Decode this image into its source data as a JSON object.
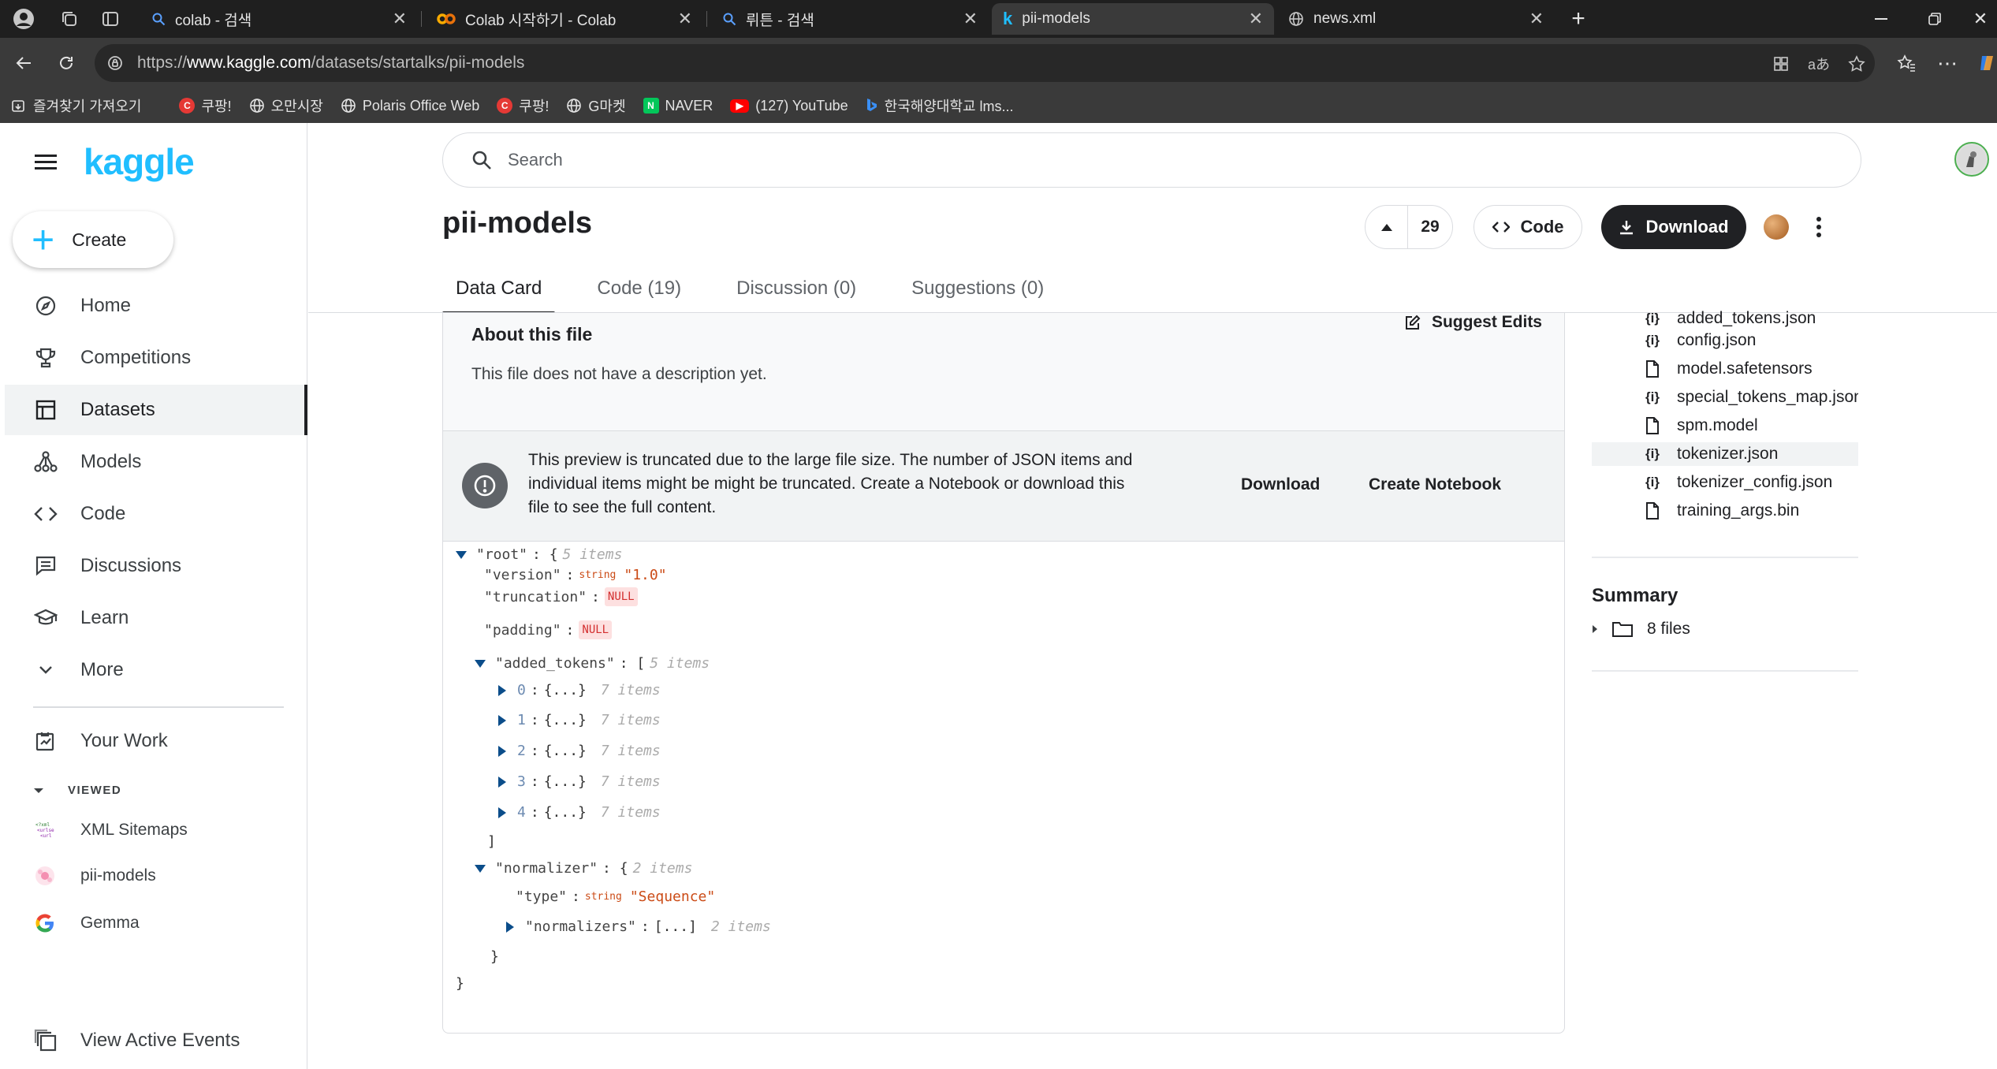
{
  "browser": {
    "tabs": [
      {
        "label": "colab - 검색",
        "icon": "bing-search-icon"
      },
      {
        "label": "Colab 시작하기 - Colab",
        "icon": "colab-icon"
      },
      {
        "label": "뤼튼 - 검색",
        "icon": "bing-search-icon"
      },
      {
        "label": "pii-models",
        "icon": "kaggle-icon",
        "active": true
      },
      {
        "label": "news.xml",
        "icon": "globe-icon"
      }
    ],
    "url_prefix": "https://",
    "url_host": "www.kaggle.com",
    "url_path": "/datasets/startalks/pii-models",
    "bookmarks": [
      {
        "label": "즐겨찾기 가져오기",
        "icon": "import-icon"
      },
      {
        "label": "쿠팡!",
        "icon": "coupang-icon"
      },
      {
        "label": "오만시장",
        "icon": "globe-icon"
      },
      {
        "label": "Polaris Office Web",
        "icon": "globe-icon"
      },
      {
        "label": "쿠팡!",
        "icon": "coupang-icon"
      },
      {
        "label": "G마켓",
        "icon": "globe-icon"
      },
      {
        "label": "NAVER",
        "icon": "naver-icon"
      },
      {
        "label": "(127) YouTube",
        "icon": "youtube-icon"
      },
      {
        "label": "한국해양대학교 lms...",
        "icon": "bing-icon"
      }
    ]
  },
  "sidebar": {
    "logo": "kaggle",
    "create_label": "Create",
    "items": [
      {
        "label": "Home",
        "icon": "compass-icon"
      },
      {
        "label": "Competitions",
        "icon": "trophy-icon"
      },
      {
        "label": "Datasets",
        "icon": "table-icon",
        "active": true
      },
      {
        "label": "Models",
        "icon": "models-icon"
      },
      {
        "label": "Code",
        "icon": "code-icon"
      },
      {
        "label": "Discussions",
        "icon": "discussion-icon"
      },
      {
        "label": "Learn",
        "icon": "learn-icon"
      },
      {
        "label": "More",
        "icon": "chevron-down-icon"
      }
    ],
    "your_work": "Your Work",
    "viewed_label": "VIEWED",
    "viewed": [
      {
        "label": "XML Sitemaps"
      },
      {
        "label": "pii-models"
      },
      {
        "label": "Gemma"
      }
    ],
    "view_events": "View Active Events"
  },
  "header": {
    "search_placeholder": "Search",
    "title": "pii-models",
    "votes": "29",
    "code_label": "Code",
    "download_label": "Download"
  },
  "tabs": [
    {
      "label": "Data Card",
      "active": true
    },
    {
      "label": "Code (19)"
    },
    {
      "label": "Discussion (0)"
    },
    {
      "label": "Suggestions (0)"
    }
  ],
  "about": {
    "title": "About this file",
    "description": "This file does not have a description yet.",
    "suggest_label": "Suggest Edits"
  },
  "notice": {
    "line1": "This preview is truncated due to the large file size. The number of JSON items and",
    "line2": "individual items might be might be truncated. Create a Notebook or download this",
    "line3": "file to see the full content.",
    "download_label": "Download",
    "notebook_label": "Create Notebook"
  },
  "json_view": {
    "root_key": "\"root\"",
    "root_count": "5 items",
    "version_key": "\"version\"",
    "version_type": "string",
    "version_val": "\"1.0\"",
    "truncation_key": "\"truncation\"",
    "padding_key": "\"padding\"",
    "null_label": "NULL",
    "added_key": "\"added_tokens\"",
    "added_count": "5 items",
    "added_items": [
      "0",
      "1",
      "2",
      "3",
      "4"
    ],
    "item_count": "7 items",
    "collapsed_obj": "{...}",
    "normalizer_key": "\"normalizer\"",
    "normalizer_count": "2 items",
    "type_key": "\"type\"",
    "type_type": "string",
    "type_val": "\"Sequence\"",
    "normalizers_key": "\"normalizers\"",
    "collapsed_arr": "[...]",
    "normalizers_count": "2 items"
  },
  "files": [
    {
      "name": "added_tokens.json",
      "icon": "json-icon"
    },
    {
      "name": "config.json",
      "icon": "json-icon"
    },
    {
      "name": "model.safetensors",
      "icon": "file-icon"
    },
    {
      "name": "special_tokens_map.json",
      "icon": "json-icon"
    },
    {
      "name": "spm.model",
      "icon": "file-icon"
    },
    {
      "name": "tokenizer.json",
      "icon": "json-icon",
      "selected": true
    },
    {
      "name": "tokenizer_config.json",
      "icon": "json-icon"
    },
    {
      "name": "training_args.bin",
      "icon": "file-icon"
    }
  ],
  "summary": {
    "title": "Summary",
    "files_label": "8 files"
  }
}
